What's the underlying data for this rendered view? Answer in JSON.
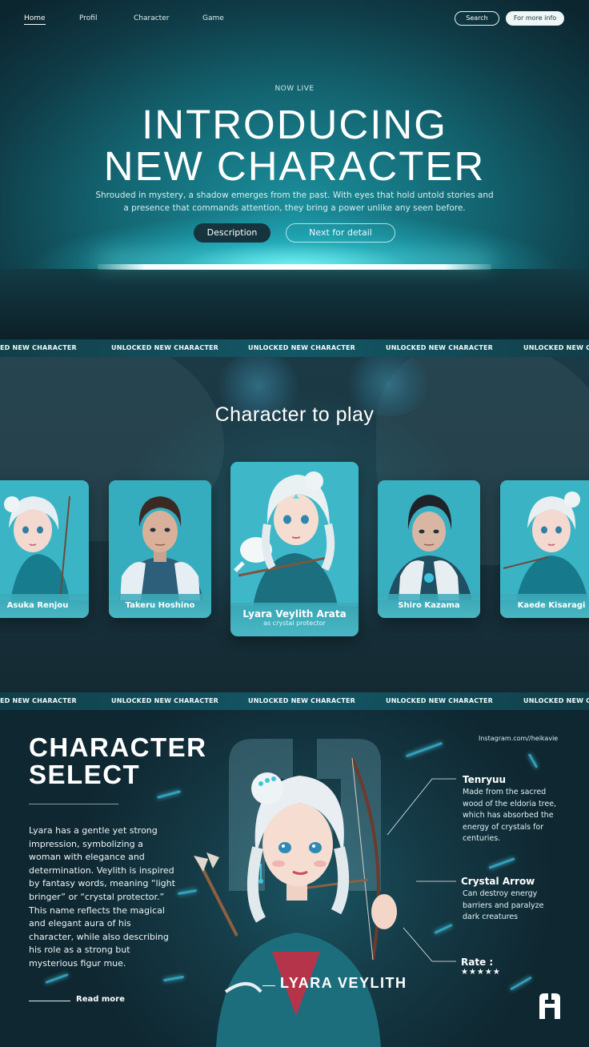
{
  "nav": {
    "links": [
      "Home",
      "Profil",
      "Character",
      "Game"
    ],
    "search": "Search",
    "more_info": "For more info"
  },
  "hero": {
    "eyebrow": "NOW LIVE",
    "title_line1": "INTRODUCING",
    "title_line2": "NEW CHARACTER",
    "description": "Shrouded in mystery, a shadow emerges from the past. With eyes that hold untold stories and a presence that commands attention, they bring a power unlike any seen before.",
    "btn_description": "Description",
    "btn_next": "Next for detail"
  },
  "ticker": {
    "items": [
      "ED NEW CHARACTER",
      "UNLOCKED NEW CHARACTER",
      "UNLOCKED NEW CHARACTER",
      "UNLOCKED NEW CHARACTER",
      "UNLOCKED NEW CHA"
    ]
  },
  "play": {
    "title": "Character to play",
    "cards": [
      {
        "name": "Asuka Renjou",
        "sub": ""
      },
      {
        "name": "Takeru Hoshino",
        "sub": ""
      },
      {
        "name": "Lyara Veylith Arata",
        "sub": "as crystal protector"
      },
      {
        "name": "Shiro Kazama",
        "sub": ""
      },
      {
        "name": "Kaede Kisaragi",
        "sub": ""
      }
    ]
  },
  "select": {
    "title_line1": "CHARACTER",
    "title_line2": "SELECT",
    "body": "Lyara has a gentle yet strong impression, symbolizing a woman with elegance and determination. Veylith is inspired by fantasy words, meaning “light bringer” or “crystal protector.” This name reflects the magical and elegant aura of his character, while also describing his role as a strong but mysterious figur mue.",
    "read_more": "Read more",
    "instagram": "Instagram.com//heikavie",
    "attributes": [
      {
        "title": "Tenryuu",
        "text": "Made from the sacred wood of the eldoria tree, which has absorbed the energy of crystals for centuries."
      },
      {
        "title": "Crystal Arrow",
        "text": "Can destroy energy barriers and paralyze dark creatures"
      },
      {
        "title": "Rate :",
        "text": "★★★★★"
      }
    ],
    "rating": 5,
    "character_name": "LYARA VEYLITH"
  },
  "colors": {
    "accent_cyan": "#4fc6d4",
    "dark_teal": "#15343d",
    "glow": "#9ff8ff"
  }
}
